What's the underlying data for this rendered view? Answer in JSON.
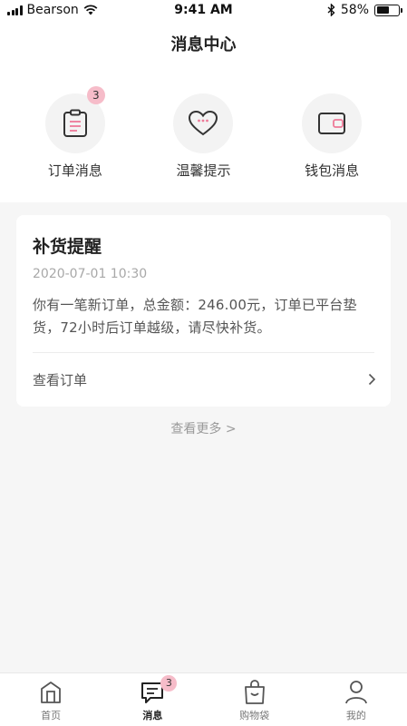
{
  "status_bar": {
    "carrier": "Bearson",
    "time": "9:41 AM",
    "battery": "58%",
    "battery_level": 0.58
  },
  "header": {
    "title": "消息中心"
  },
  "categories": [
    {
      "label": "订单消息",
      "icon": "clipboard-icon",
      "badge": "3"
    },
    {
      "label": "温馨提示",
      "icon": "heart-icon",
      "badge": ""
    },
    {
      "label": "钱包消息",
      "icon": "wallet-icon",
      "badge": ""
    }
  ],
  "card": {
    "title": "补货提醒",
    "time": "2020-07-01 10:30",
    "body": "你有一笔新订单，总金额：246.00元，订单已平台垫货，72小时后订单越级，请尽快补货。",
    "action_label": "查看订单"
  },
  "more_link": "查看更多 >",
  "tabbar": [
    {
      "label": "首页",
      "icon": "home-icon",
      "active": false,
      "badge": ""
    },
    {
      "label": "消息",
      "icon": "message-icon",
      "active": true,
      "badge": "3"
    },
    {
      "label": "购物袋",
      "icon": "shopping-bag-icon",
      "active": false,
      "badge": ""
    },
    {
      "label": "我的",
      "icon": "user-icon",
      "active": false,
      "badge": ""
    }
  ],
  "colors": {
    "accent": "#f6bcc9",
    "icon_stroke": "#333333",
    "icon_accent": "#ee7a98",
    "background": "#f6f6f6"
  }
}
